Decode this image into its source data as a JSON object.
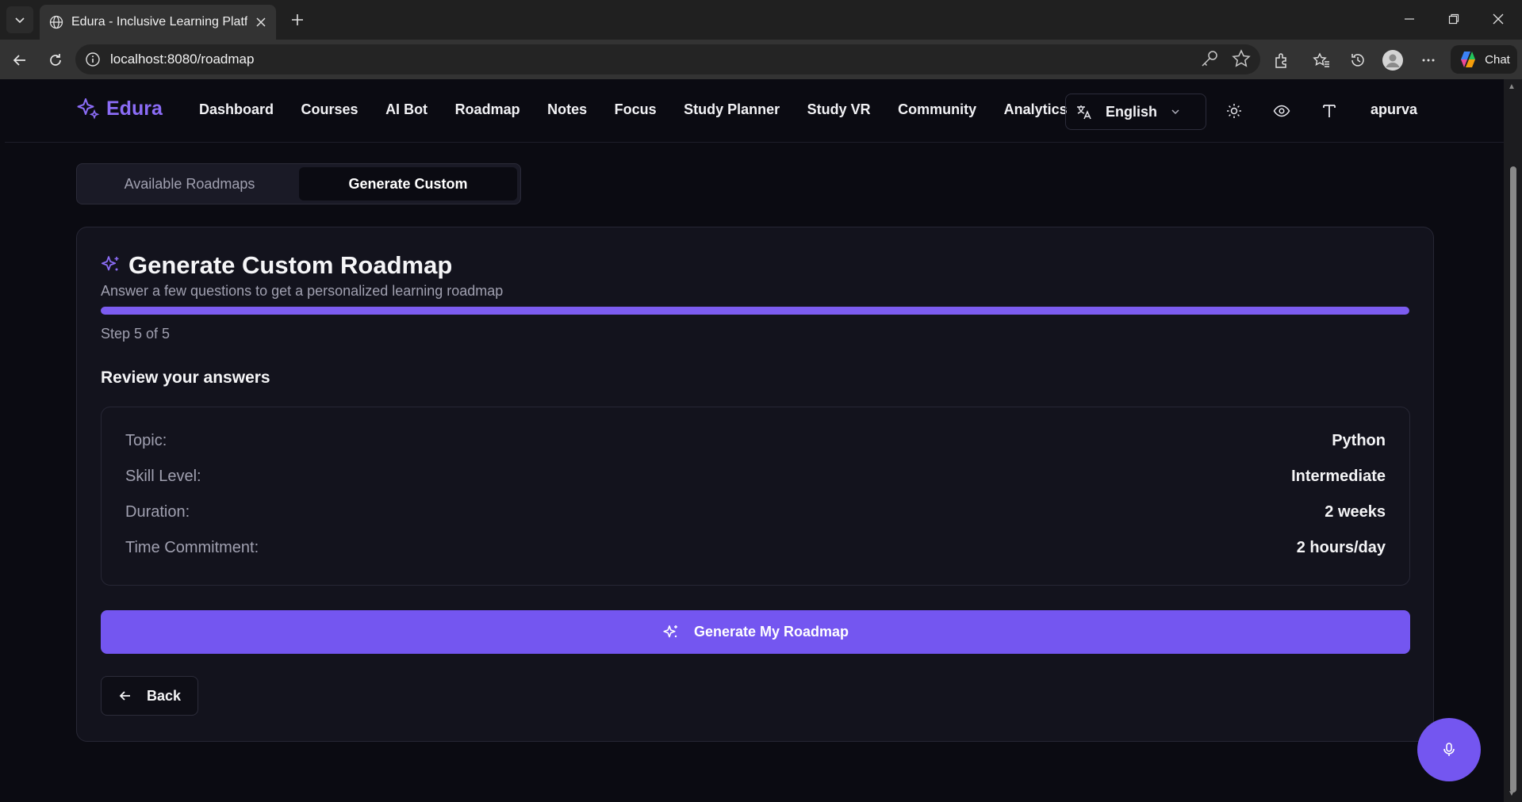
{
  "browser": {
    "tab_title": "Edura - Inclusive Learning Platform",
    "url": "localhost:8080/roadmap",
    "chat_label": "Chat"
  },
  "nav": {
    "brand": "Edura",
    "links": [
      "Dashboard",
      "Courses",
      "AI Bot",
      "Roadmap",
      "Notes",
      "Focus",
      "Study Planner",
      "Study VR",
      "Community",
      "Analytics"
    ],
    "language": "English",
    "user": "apurva"
  },
  "tabs": {
    "available": "Available Roadmaps",
    "custom": "Generate Custom"
  },
  "card": {
    "title": "Generate Custom Roadmap",
    "subtitle": "Answer a few questions to get a personalized learning roadmap",
    "progress_percent": 100,
    "step_text": "Step 5 of 5",
    "review_heading": "Review your answers",
    "answers": [
      {
        "label": "Topic:",
        "value": "Python"
      },
      {
        "label": "Skill Level:",
        "value": "Intermediate"
      },
      {
        "label": "Duration:",
        "value": "2 weeks"
      },
      {
        "label": "Time Commitment:",
        "value": "2 hours/day"
      }
    ],
    "generate_label": "Generate My Roadmap",
    "back_label": "Back"
  },
  "colors": {
    "accent": "#7456f0",
    "brand": "#8b6cf6",
    "background": "#0b0b12",
    "card": "#13131d"
  }
}
